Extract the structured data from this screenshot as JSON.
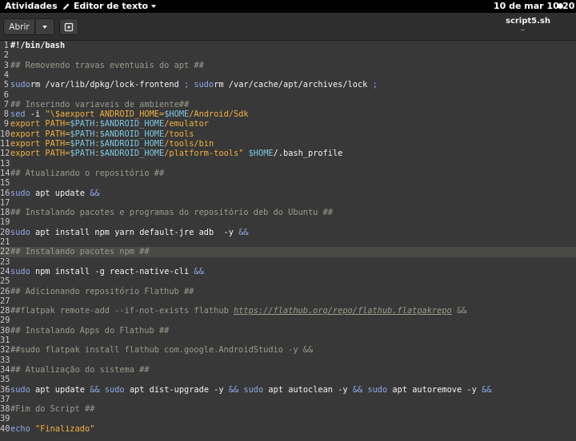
{
  "topbar": {
    "activities": "Atividades",
    "app_menu": "Editor de texto",
    "clock": "10 de mar  10:20"
  },
  "header": {
    "open_label": "Abrir",
    "tab_title": "script5.sh",
    "tab_subtitle": "~"
  },
  "icons": [
    "pencil-icon",
    "chevron-down-icon",
    "new-document-icon",
    "status-dot-icon"
  ],
  "colors": {
    "background": "#383838",
    "comment": "#9a9a8f",
    "keyword": "#8fa8e8",
    "string": "#f0b040",
    "variable": "#7fc7e0",
    "current_line": "#4a4a44"
  },
  "current_line": 22,
  "lines": [
    {
      "n": "1",
      "t": [
        [
          "sh",
          "#!/bin/bash"
        ]
      ]
    },
    {
      "n": "2",
      "t": []
    },
    {
      "n": "3",
      "t": [
        [
          "cmt",
          "## Removendo travas eventuais do apt ##"
        ]
      ]
    },
    {
      "n": "4",
      "t": []
    },
    {
      "n": "5",
      "t": [
        [
          "kw",
          "sudo"
        ],
        [
          "",
          "rm /var/lib/dpkg/lock-frontend "
        ],
        [
          "kw",
          ";"
        ],
        [
          "",
          ""
        ],
        [
          "kw",
          " sudo"
        ],
        [
          "",
          "rm /var/cache/apt/archives/lock "
        ],
        [
          "kw",
          ";"
        ]
      ]
    },
    {
      "n": "6",
      "t": []
    },
    {
      "n": "7",
      "t": [
        [
          "cmt",
          "## Inserindo variaveis de ambiente##"
        ]
      ]
    },
    {
      "n": "8",
      "t": [
        [
          "kw",
          "sed"
        ],
        [
          "",
          " -i "
        ],
        [
          "str",
          "\"\\$aexport ANDROID_HOME="
        ],
        [
          "var",
          "$HOME"
        ],
        [
          "str",
          "/Android/Sdk"
        ]
      ]
    },
    {
      "n": "9",
      "t": [
        [
          "str",
          "export PATH="
        ],
        [
          "var",
          "$PATH"
        ],
        [
          "str",
          ":"
        ],
        [
          "var",
          "$ANDROID_HOME"
        ],
        [
          "str",
          "/emulator"
        ]
      ]
    },
    {
      "n": "10",
      "t": [
        [
          "str",
          "export PATH="
        ],
        [
          "var",
          "$PATH"
        ],
        [
          "str",
          ":"
        ],
        [
          "var",
          "$ANDROID_HOME"
        ],
        [
          "str",
          "/tools"
        ]
      ]
    },
    {
      "n": "11",
      "t": [
        [
          "str",
          "export PATH="
        ],
        [
          "var",
          "$PATH"
        ],
        [
          "str",
          ":"
        ],
        [
          "var",
          "$ANDROID_HOME"
        ],
        [
          "str",
          "/tools/bin"
        ]
      ]
    },
    {
      "n": "12",
      "t": [
        [
          "str",
          "export PATH="
        ],
        [
          "var",
          "$PATH"
        ],
        [
          "str",
          ":"
        ],
        [
          "var",
          "$ANDROID_HOME"
        ],
        [
          "str",
          "/platform-tools\" "
        ],
        [
          "var",
          "$HOME"
        ],
        [
          "",
          "/.bash_profile"
        ]
      ]
    },
    {
      "n": "13",
      "t": []
    },
    {
      "n": "14",
      "t": [
        [
          "cmt",
          "## Atualizando o repositório ##"
        ]
      ]
    },
    {
      "n": "15",
      "t": []
    },
    {
      "n": "16",
      "t": [
        [
          "kw",
          "sudo"
        ],
        [
          "",
          " apt update "
        ],
        [
          "kw",
          "&&"
        ]
      ]
    },
    {
      "n": "17",
      "t": []
    },
    {
      "n": "18",
      "t": [
        [
          "cmt",
          "## Instalando pacotes e programas do repositório deb do Ubuntu ##"
        ]
      ]
    },
    {
      "n": "19",
      "t": []
    },
    {
      "n": "20",
      "t": [
        [
          "kw",
          "sudo"
        ],
        [
          "",
          " apt install npm yarn default-jre adb  -y "
        ],
        [
          "kw",
          "&&"
        ]
      ]
    },
    {
      "n": "21",
      "t": []
    },
    {
      "n": "22",
      "t": [
        [
          "cmt",
          "## Instalando pacotes npm ##"
        ]
      ]
    },
    {
      "n": "23",
      "t": []
    },
    {
      "n": "24",
      "t": [
        [
          "kw",
          "sudo"
        ],
        [
          "",
          " npm install -g react-native-cli "
        ],
        [
          "kw",
          "&&"
        ]
      ]
    },
    {
      "n": "25",
      "t": []
    },
    {
      "n": "26",
      "t": [
        [
          "cmt",
          "## Adicionando repositório Flathub ##"
        ]
      ]
    },
    {
      "n": "27",
      "t": []
    },
    {
      "n": "28",
      "t": [
        [
          "cmt",
          "##flatpak remote-add --if-not-exists flathub "
        ],
        [
          "url",
          "https://flathub.org/repo/flathub.flatpakrepo"
        ],
        [
          "cmt",
          " &&"
        ]
      ]
    },
    {
      "n": "29",
      "t": []
    },
    {
      "n": "30",
      "t": [
        [
          "cmt",
          "## Instalando Apps do Flathub ##"
        ]
      ]
    },
    {
      "n": "31",
      "t": []
    },
    {
      "n": "32",
      "t": [
        [
          "cmt",
          "##sudo flatpak install flathub com.google.AndroidStudio -y &&"
        ]
      ]
    },
    {
      "n": "33",
      "t": []
    },
    {
      "n": "34",
      "t": [
        [
          "cmt",
          "## Atualização do sistema ##"
        ]
      ]
    },
    {
      "n": "35",
      "t": []
    },
    {
      "n": "36",
      "t": [
        [
          "kw",
          "sudo"
        ],
        [
          "",
          " apt update "
        ],
        [
          "kw",
          "&& sudo"
        ],
        [
          "",
          " apt dist-upgrade -y "
        ],
        [
          "kw",
          "&& sudo"
        ],
        [
          "",
          " apt autoclean -y "
        ],
        [
          "kw",
          "&& sudo"
        ],
        [
          "",
          " apt autoremove -y "
        ],
        [
          "kw",
          "&&"
        ]
      ]
    },
    {
      "n": "37",
      "t": []
    },
    {
      "n": "38",
      "t": [
        [
          "cmt",
          "#Fim do Script ##"
        ]
      ]
    },
    {
      "n": "39",
      "t": []
    },
    {
      "n": "40",
      "t": [
        [
          "kw",
          "echo"
        ],
        [
          "",
          " "
        ],
        [
          "str",
          "\"Finalizado\""
        ]
      ]
    }
  ]
}
